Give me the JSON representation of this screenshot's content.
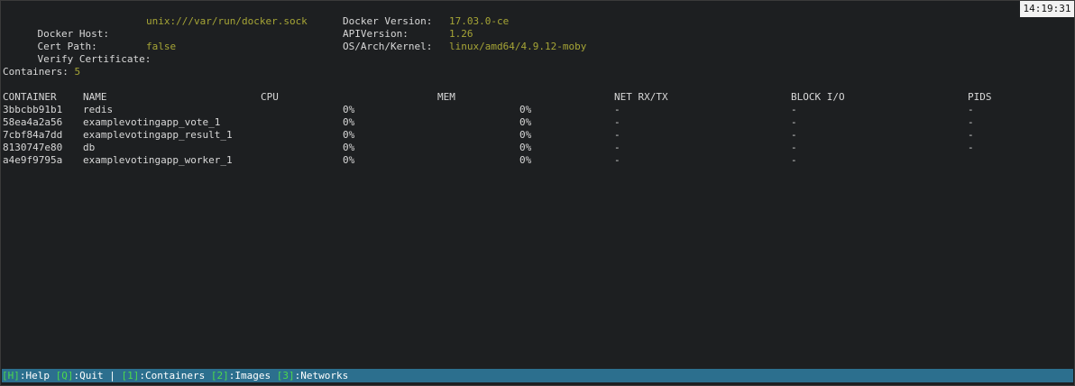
{
  "clock": "14:19:31",
  "info": {
    "docker_host_label": "Docker Host:",
    "docker_host_value": "unix:///var/run/docker.sock",
    "cert_path_label": "Cert Path:",
    "cert_path_value": "",
    "verify_cert_label": "Verify Certificate:",
    "verify_cert_value": "false",
    "docker_version_label": "Docker Version:",
    "docker_version_value": "17.03.0-ce",
    "api_version_label": "APIVersion:",
    "api_version_value": "1.26",
    "os_arch_label": "OS/Arch/Kernel:",
    "os_arch_value": "linux/amd64/4.9.12-moby"
  },
  "containers_summary": {
    "label": "Containers:",
    "count": "5"
  },
  "table": {
    "headers": {
      "container": "CONTAINER",
      "name": "NAME",
      "cpu": "CPU",
      "mem": "MEM",
      "net": "NET RX/TX",
      "block": "BLOCK I/O",
      "pids": "PIDS"
    },
    "rows": [
      {
        "id": "3bbcbb91b1",
        "name": "redis",
        "cpu": "0%",
        "mem": "0%",
        "net": "-",
        "block": "-",
        "pids": "-"
      },
      {
        "id": "58ea4a2a56",
        "name": "examplevotingapp_vote_1",
        "cpu": "0%",
        "mem": "0%",
        "net": "-",
        "block": "-",
        "pids": "-"
      },
      {
        "id": "7cbf84a7dd",
        "name": "examplevotingapp_result_1",
        "cpu": "0%",
        "mem": "0%",
        "net": "-",
        "block": "-",
        "pids": "-"
      },
      {
        "id": "8130747e80",
        "name": "db",
        "cpu": "0%",
        "mem": "0%",
        "net": "-",
        "block": "-",
        "pids": "-"
      },
      {
        "id": "a4e9f9795a",
        "name": "examplevotingapp_worker_1",
        "cpu": "0%",
        "mem": "0%",
        "net": "-",
        "block": "-",
        "pids": ""
      }
    ]
  },
  "statusbar": {
    "help_key": "[H]",
    "help_label": ":Help",
    "quit_key": "[Q]",
    "quit_label": ":Quit",
    "separator": "|",
    "containers_key": "[1]",
    "containers_label": ":Containers",
    "images_key": "[2]",
    "images_label": ":Images",
    "networks_key": "[3]",
    "networks_label": ":Networks"
  },
  "colors": {
    "background": "#1d1f21",
    "value_text": "#a6a536",
    "statusbar_bg": "#2c6f8e",
    "statusbar_key": "#4cd94c"
  }
}
